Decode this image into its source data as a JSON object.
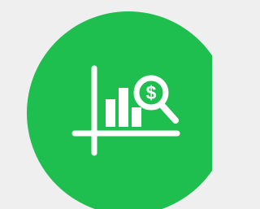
{
  "icon": {
    "name": "financial-analysis-chart-icon",
    "symbol": "$"
  },
  "colors": {
    "background": "#efefef",
    "badge": "#1ebe4f",
    "icon": "#ffffff"
  }
}
